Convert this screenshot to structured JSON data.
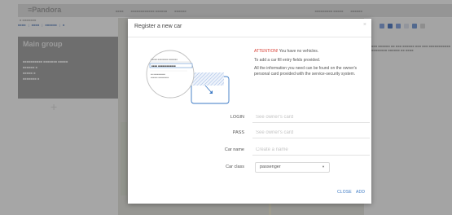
{
  "app": {
    "logo": "≡Pandora",
    "top_nav": [
      "■■■■",
      "■■■■■■■■■■■■ ■■■■■■",
      "■■■■■■"
    ],
    "top_right": [
      "■■■■■■■■■ ■■■■■",
      "■■■■■■"
    ],
    "sub_info": "■ ■■■■■■■",
    "sub_nav": [
      "■■■■",
      "|",
      "■■■■",
      "|",
      "■■■■■■",
      "|",
      "■"
    ]
  },
  "left_panel": {
    "title": "Main group",
    "lines": [
      "■■■■■■■■■■   ■■■■■■■  ■■■■■",
      "■■■■■■   ■",
      "■■■■■   ■",
      "■■■■■■■  ■"
    ],
    "add_glyph": "+"
  },
  "right_panel": {
    "text": "■■■ ■■■■■■ ■■ ■■■ ■■■■■■ ■■■ ■■■ ■■■■■■■■■■■ ■■■■■■■■ ■■■■■■ ■■ ■■■■"
  },
  "colors": {
    "toolbar": [
      "#6c8fd1",
      "#2f5fb3",
      "#6c8fd1",
      "#d0d6e2",
      "#5b86c8",
      "#c9c9c9"
    ],
    "accent": "#3b79c4",
    "alert": "#d73a2f"
  },
  "modal": {
    "title": "Register a new car",
    "close_icon": "×",
    "illustration": {
      "card_row": "■■■■■  ■■■■■■■■  ■■■■■■■",
      "card_code": "■■■■ ■■■■■■■■■■■■",
      "card_line1": "■■ ■■■■■■■■■■",
      "card_line2": "■■■■■■ ■■■■■■■■■"
    },
    "attention_label": "ATTENTION!",
    "attention_text": "You have no vehicles.",
    "info1": "To add a car fill entry fields provided.",
    "info2": "All the information you need can be found on the owner's personal card provided with the service-security system.",
    "fields": [
      {
        "label": "LOGIN",
        "placeholder": "See owner's card"
      },
      {
        "label": "PASS",
        "placeholder": "See owner's card"
      },
      {
        "label": "Car name",
        "placeholder": "Create a name"
      }
    ],
    "car_class": {
      "label": "Car class",
      "value": "passenger"
    },
    "close_button": "CLOSE",
    "add_button": "ADD"
  }
}
